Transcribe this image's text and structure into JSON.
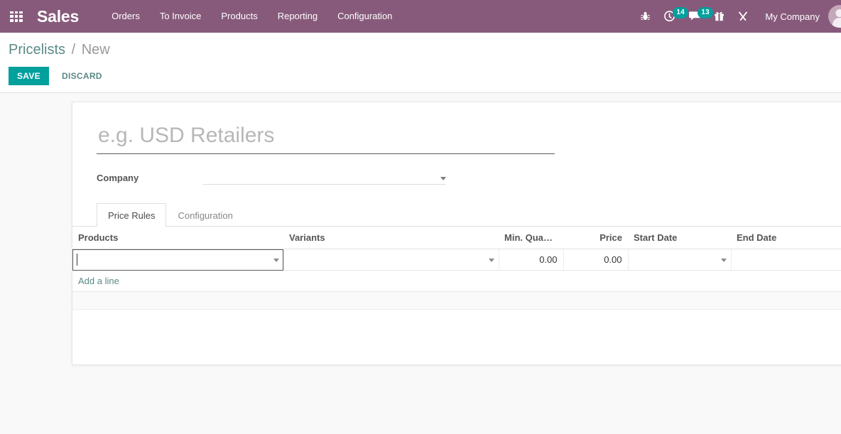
{
  "navbar": {
    "apps_icon": "apps-grid-icon",
    "brand": "Sales",
    "menu": [
      {
        "label": "Orders"
      },
      {
        "label": "To Invoice"
      },
      {
        "label": "Products"
      },
      {
        "label": "Reporting"
      },
      {
        "label": "Configuration"
      }
    ],
    "systray": [
      {
        "icon": "bug-icon",
        "badge": null
      },
      {
        "icon": "activity-clock-icon",
        "badge": "14"
      },
      {
        "icon": "messages-icon",
        "badge": "13"
      },
      {
        "icon": "gift-icon",
        "badge": null
      },
      {
        "icon": "tools-icon",
        "badge": null
      }
    ],
    "company_label": "My Company",
    "avatar": "user-avatar",
    "background_color": "#875A7B",
    "badge_color": "#00A09D"
  },
  "control_panel": {
    "breadcrumb": {
      "parent": "Pricelists",
      "separator": "/",
      "current": "New"
    },
    "save_label": "SAVE",
    "discard_label": "DISCARD",
    "save_color": "#00A09D",
    "link_color": "#5a8a86"
  },
  "form": {
    "title_placeholder": "e.g. USD Retailers",
    "title_value": "",
    "company": {
      "label": "Company",
      "value": "",
      "placeholder": ""
    }
  },
  "notebook": {
    "tabs": [
      {
        "label": "Price Rules",
        "active": true
      },
      {
        "label": "Configuration",
        "active": false
      }
    ]
  },
  "price_rules": {
    "columns": [
      {
        "label": "Products",
        "align": "left"
      },
      {
        "label": "Variants",
        "align": "left"
      },
      {
        "label": "Min. Quant...",
        "align": "right"
      },
      {
        "label": "Price",
        "align": "right"
      },
      {
        "label": "Start Date",
        "align": "left"
      },
      {
        "label": "End Date",
        "align": "left"
      }
    ],
    "rows": [
      {
        "products": "",
        "variants": "",
        "min_quantity": "0.00",
        "price": "0.00",
        "start_date": "",
        "end_date": ""
      }
    ],
    "add_line_label": "Add a line"
  }
}
